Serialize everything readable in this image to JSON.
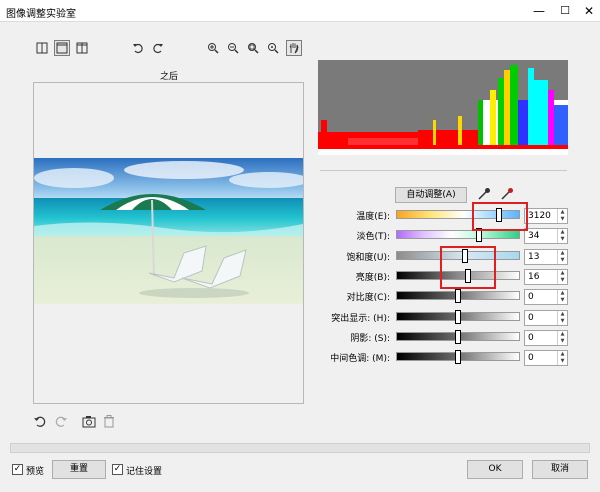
{
  "window": {
    "title": "图像调整实验室",
    "minimize_glyph": "—",
    "restore_glyph": "☐",
    "close_glyph": "✕"
  },
  "toolbar": {
    "view_icons": [
      "split-view-icon",
      "single-view-icon",
      "side-by-side-icon"
    ],
    "rotate_icons": [
      "rotate-left-icon",
      "rotate-right-icon"
    ],
    "zoom_icons": [
      "zoom-in-icon",
      "zoom-out-icon",
      "zoom-fit-icon",
      "zoom-actual-icon",
      "pan-hand-icon"
    ]
  },
  "preview": {
    "label": "之后"
  },
  "adjust": {
    "auto_button": "自动调整(A)"
  },
  "sliders": [
    {
      "label": "温度(E):",
      "value": "3120",
      "level": 0.83,
      "track": "linear-gradient(to right,#f5a623,#ffe57a,#ffffff 55%,#bfe6ff 70%,#5ab4ff)"
    },
    {
      "label": "淡色(T):",
      "value": "34",
      "level": 0.67,
      "track": "linear-gradient(to right,#b36cff,#e0c4ff,#ffffff 45%,#b6f5d6 70%,#2ad28a)"
    },
    {
      "label": "饱和度(U):",
      "value": "13",
      "level": 0.56,
      "track": "linear-gradient(to right,#8c8c8c,#d7e8f3 55%,#a6d9ef)"
    },
    {
      "label": "亮度(B):",
      "value": "16",
      "level": 0.58,
      "track": "linear-gradient(to right,#000000,#8a8a8a 50%,#ffffff)"
    },
    {
      "label": "对比度(C):",
      "value": "0",
      "level": 0.5,
      "track": "linear-gradient(to right,#000000,#6e6e6e 50%,#ffffff)"
    },
    {
      "label": "突出显示: (H):",
      "value": "0",
      "level": 0.5,
      "track": "linear-gradient(to right,#000000,#6e6e6e 50%,#ffffff)"
    },
    {
      "label": "阴影: (S):",
      "value": "0",
      "level": 0.5,
      "track": "linear-gradient(to right,#000000,#6e6e6e 50%,#ffffff)"
    },
    {
      "label": "中间色调: (M):",
      "value": "0",
      "level": 0.5,
      "track": "linear-gradient(to right,#000000,#6e6e6e 50%,#ffffff)"
    }
  ],
  "bottom_tools": [
    "undo-icon",
    "redo-icon",
    "snapshot-icon",
    "delete-icon"
  ],
  "footer": {
    "preview_label": "预览",
    "reset_button": "重置",
    "remember_label": "记住设置",
    "ok_button": "OK",
    "cancel_button": "取消",
    "check_glyph": "✓"
  },
  "colors": {
    "highlight_box": "#e02020"
  }
}
